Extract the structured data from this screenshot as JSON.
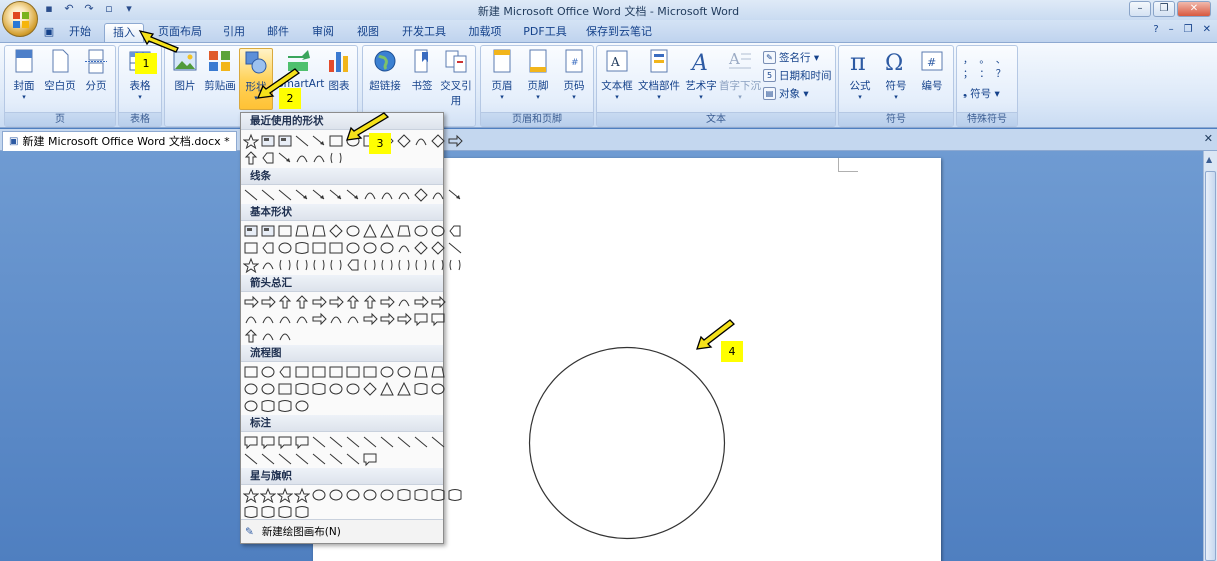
{
  "window": {
    "title": "新建 Microsoft Office Word 文档 - Microsoft Word",
    "min": "–",
    "max": "❐",
    "close": "✕"
  },
  "tabs": [
    {
      "label": "开始"
    },
    {
      "label": "插入",
      "active": true
    },
    {
      "label": "页面布局"
    },
    {
      "label": "引用"
    },
    {
      "label": "邮件"
    },
    {
      "label": "审阅"
    },
    {
      "label": "视图"
    },
    {
      "label": "开发工具"
    },
    {
      "label": "加载项"
    },
    {
      "label": "PDF工具"
    },
    {
      "label": "保存到云笔记"
    }
  ],
  "ribbon": {
    "groups": {
      "page": "页",
      "table": "表格",
      "header_footer": "页眉和页脚",
      "text": "文本",
      "symbols": "符号",
      "special_symbols": "特殊符号"
    },
    "buttons": {
      "cover": "封面",
      "blank": "空白页",
      "break": "分页",
      "table": "表格",
      "picture": "图片",
      "clipart": "剪贴画",
      "shapes": "形状",
      "smartart": "SmartArt",
      "chart": "图表",
      "hyperlink": "超链接",
      "bookmark": "书签",
      "crossref": "交叉引用",
      "header": "页眉",
      "footer": "页脚",
      "pagenum": "页码",
      "textbox": "文本框",
      "quickparts": "文档部件",
      "wordart": "艺术字",
      "dropcap": "首字下沉",
      "signature": "签名行 ▾",
      "datetime": "日期和时间",
      "object": "对象 ▾",
      "equation": "公式",
      "symbol": "符号",
      "number": "编号",
      "special_symbol": "符号 ▾"
    },
    "special_chars": "，  。  、\n；  ：  ？"
  },
  "doc_tab": {
    "label": "新建 Microsoft Office Word 文档.docx *"
  },
  "shapes_menu": {
    "categories": {
      "recent": "最近使用的形状",
      "lines": "线条",
      "basic": "基本形状",
      "arrows": "箭头总汇",
      "flowchart": "流程图",
      "callouts": "标注",
      "stars": "星与旗帜"
    },
    "new_canvas": "新建绘图画布(N)"
  },
  "annotations": [
    "1",
    "2",
    "3",
    "4"
  ],
  "colors": {
    "badge": "#ffff00",
    "arrow": "#f5e11a",
    "highlight": "#ffc235"
  }
}
